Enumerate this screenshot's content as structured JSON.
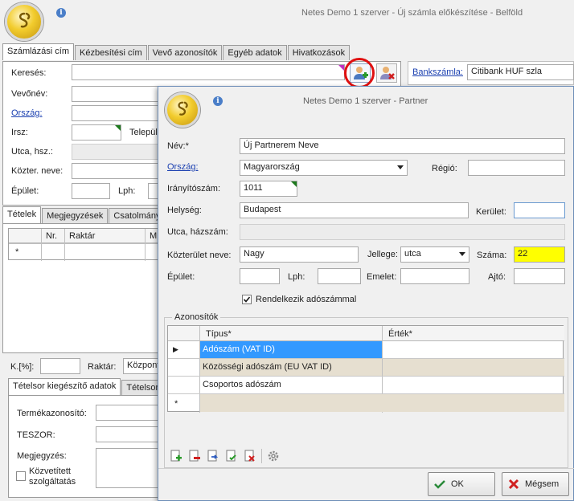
{
  "main_window": {
    "title": "Netes Demo 1 szerver - Új számla előkészítése - Belföld",
    "tabs": [
      "Számlázási cím",
      "Kézbesítési cím",
      "Vevő azonosítók",
      "Egyéb adatok",
      "Hivatkozások"
    ],
    "labels": {
      "kereses": "Keresés:",
      "vevonev": "Vevőnév:",
      "orszag": "Ország:",
      "irsz": "Irsz:",
      "telepules": "Település",
      "utca": "Utca, hsz.:",
      "kozter": "Közter. neve:",
      "epulet": "Épület:",
      "lph": "Lph:",
      "bankszamla": "Bankszámla:",
      "kpct": "K.[%]:",
      "raktar": "Raktár:",
      "termekazonosito": "Termékazonosító:",
      "teszor": "TESZOR:",
      "megjegyzes": "Megjegyzés:",
      "kozvetitett": "Közvetített szolgáltatás"
    },
    "bankszamla_value": "Citibank HUF szla",
    "raktar_value": "Központ",
    "lower_tabs": [
      "Tételek",
      "Megjegyzések",
      "Csatolmányo"
    ],
    "item_grid_columns": [
      "Nr.",
      "Raktár",
      "M"
    ],
    "item_grid_new_row_marker": "*",
    "detail_tabs": [
      "Tételsor kiegészítő adatok",
      "Tételsor"
    ]
  },
  "dialog": {
    "title": "Netes Demo 1 szerver - Partner",
    "labels": {
      "nev": "Név:*",
      "orszag": "Ország:",
      "regio": "Régió:",
      "iranyitoszam": "Irányítószám:",
      "helyseg": "Helység:",
      "kerulet": "Kerület:",
      "utca_hazszam": "Utca, házszám:",
      "kozterulet_neve": "Közterület neve:",
      "jellege": "Jellege:",
      "szama": "Száma:",
      "epulet": "Épület:",
      "lph": "Lph:",
      "emelet": "Emelet:",
      "ajto": "Ajtó:",
      "adoszam_checkbox": "Rendelkezik adószámmal",
      "azonositok": "Azonosítók"
    },
    "values": {
      "nev": "Új Partnerem Neve",
      "orszag": "Magyarország",
      "regio": "",
      "iranyitoszam": "1011",
      "helyseg": "Budapest",
      "kerulet": "",
      "kozterulet_neve": "Nagy",
      "jellege": "utca",
      "szama": "22"
    },
    "adoszam_checked": true,
    "grid": {
      "columns": [
        "Típus*",
        "Érték*"
      ],
      "rows": [
        {
          "tipus": "Adószám (VAT ID)",
          "ertek": ""
        },
        {
          "tipus": "Közösségi adószám (EU VAT ID)",
          "ertek": ""
        },
        {
          "tipus": "Csoportos adószám",
          "ertek": ""
        }
      ],
      "current_row_marker": "▶",
      "new_row_marker": "*"
    },
    "buttons": {
      "ok": "OK",
      "cancel": "Mégsem"
    },
    "colors": {
      "highlight": "#ffff00",
      "selected_row": "#3399ff"
    }
  }
}
